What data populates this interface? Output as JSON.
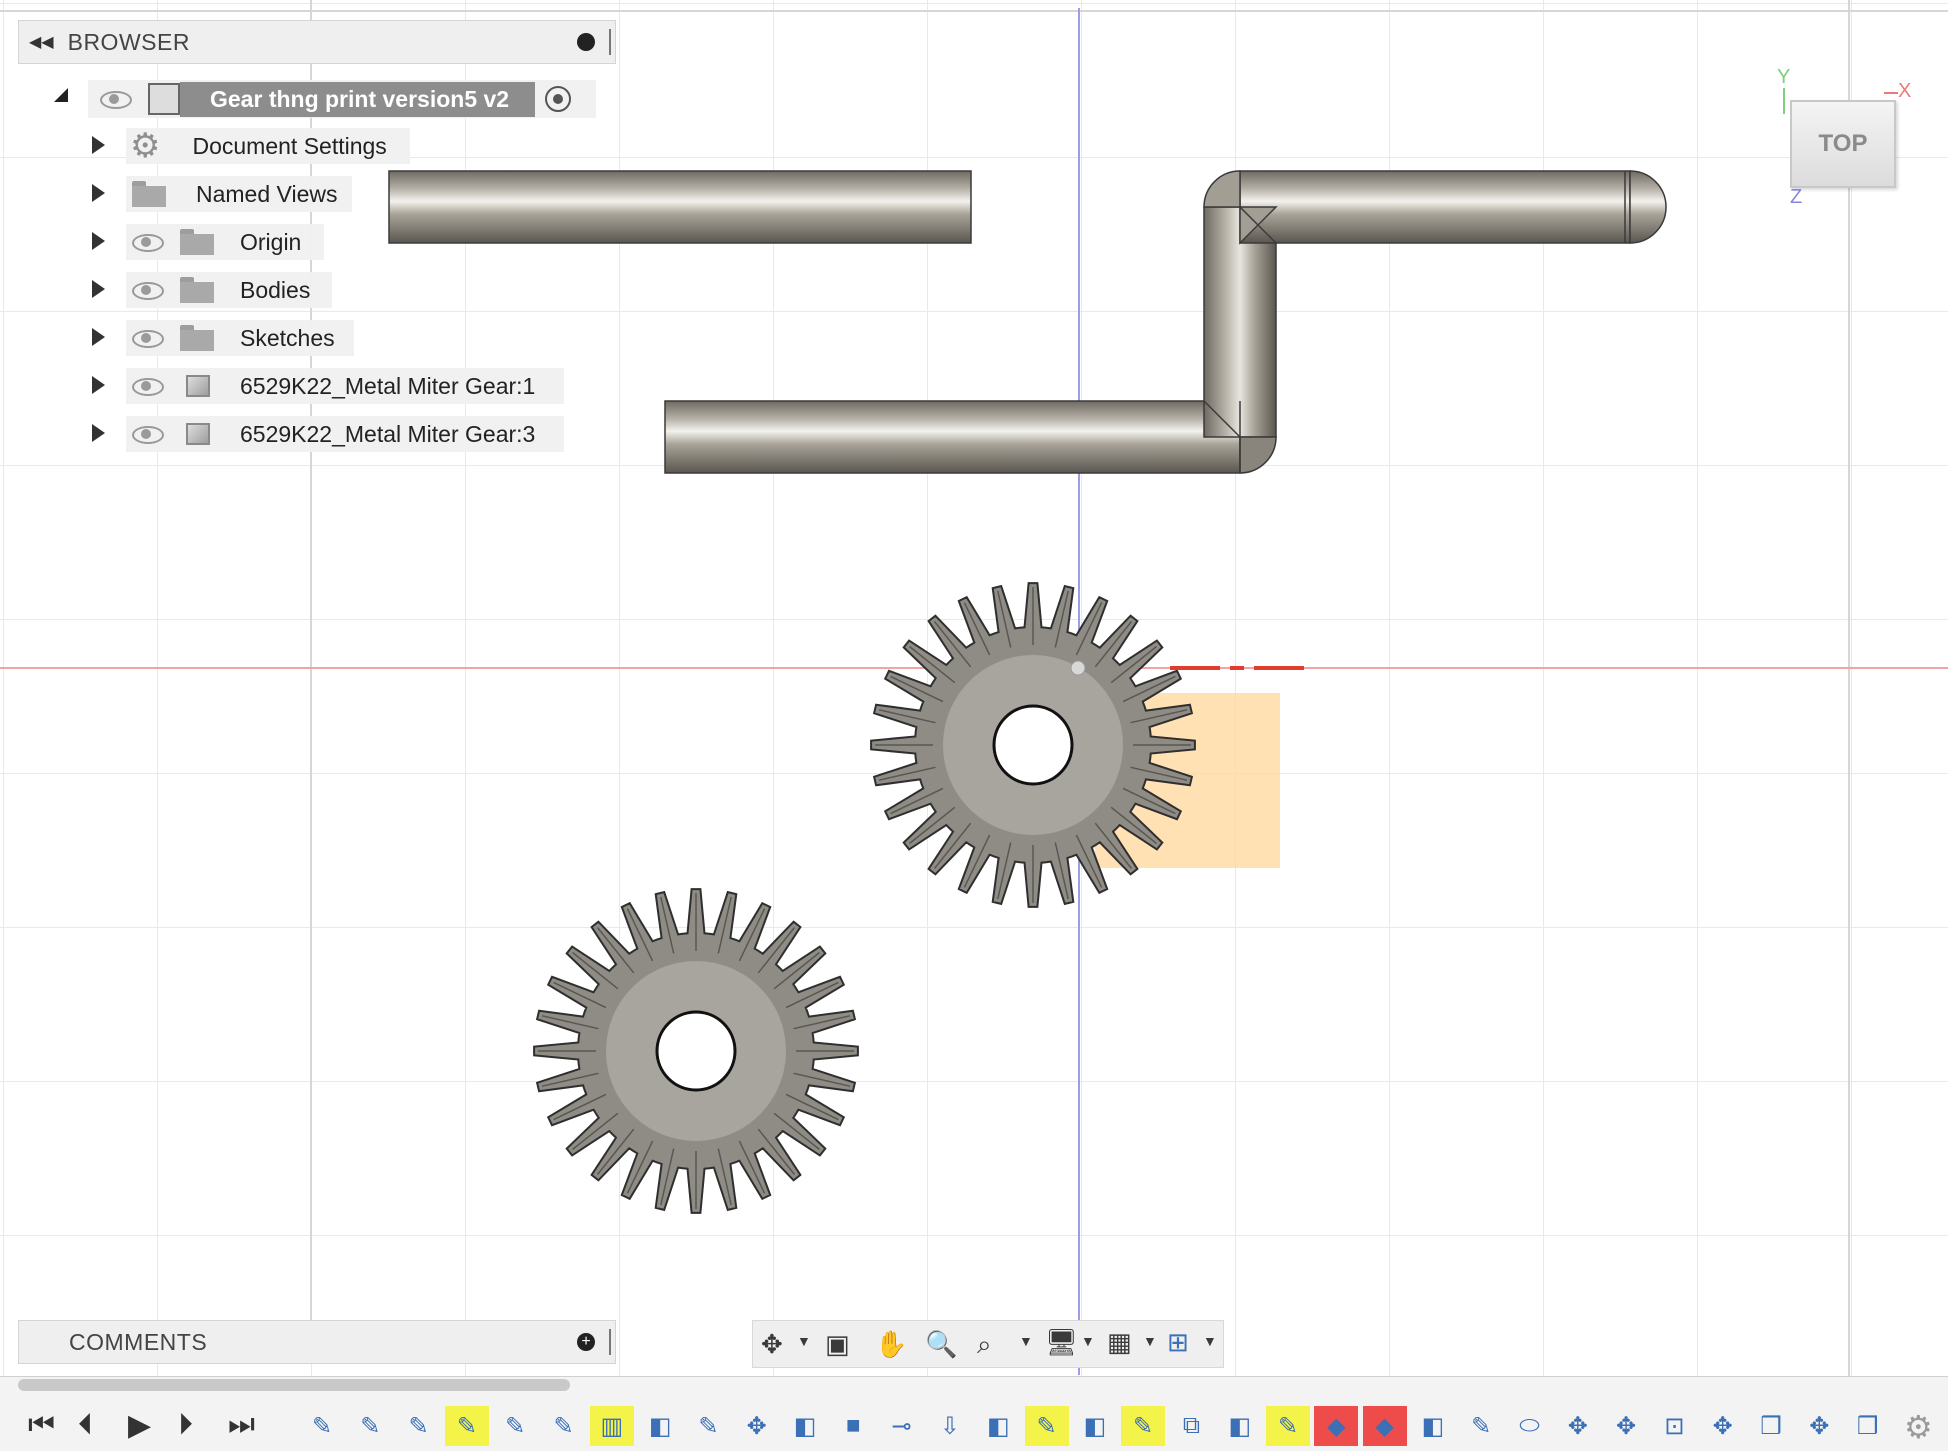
{
  "browser": {
    "title": "BROWSER",
    "root": "Gear thng print version5 v2",
    "items": [
      {
        "label": "Document Settings",
        "icon": "gear-icon"
      },
      {
        "label": "Named Views",
        "icon": "folder-icon"
      },
      {
        "label": "Origin",
        "icon": "folder-icon"
      },
      {
        "label": "Bodies",
        "icon": "folder-icon"
      },
      {
        "label": "Sketches",
        "icon": "folder-icon"
      },
      {
        "label": "6529K22_Metal Miter Gear:1",
        "icon": "component-icon"
      },
      {
        "label": "6529K22_Metal Miter Gear:3",
        "icon": "component-icon"
      }
    ]
  },
  "viewcube": {
    "face": "TOP",
    "x_label": "X",
    "y_label": "Y",
    "z_label": "Z"
  },
  "comments": {
    "title": "COMMENTS"
  },
  "colors": {
    "x_axis": "#f2a4a4",
    "z_axis": "#9c9ce8",
    "selection": "#ffd79a",
    "toolbar_blue": "#3b6fb6",
    "highlight_yellow": "#f3f34a",
    "highlight_red": "#ee4b4b"
  }
}
